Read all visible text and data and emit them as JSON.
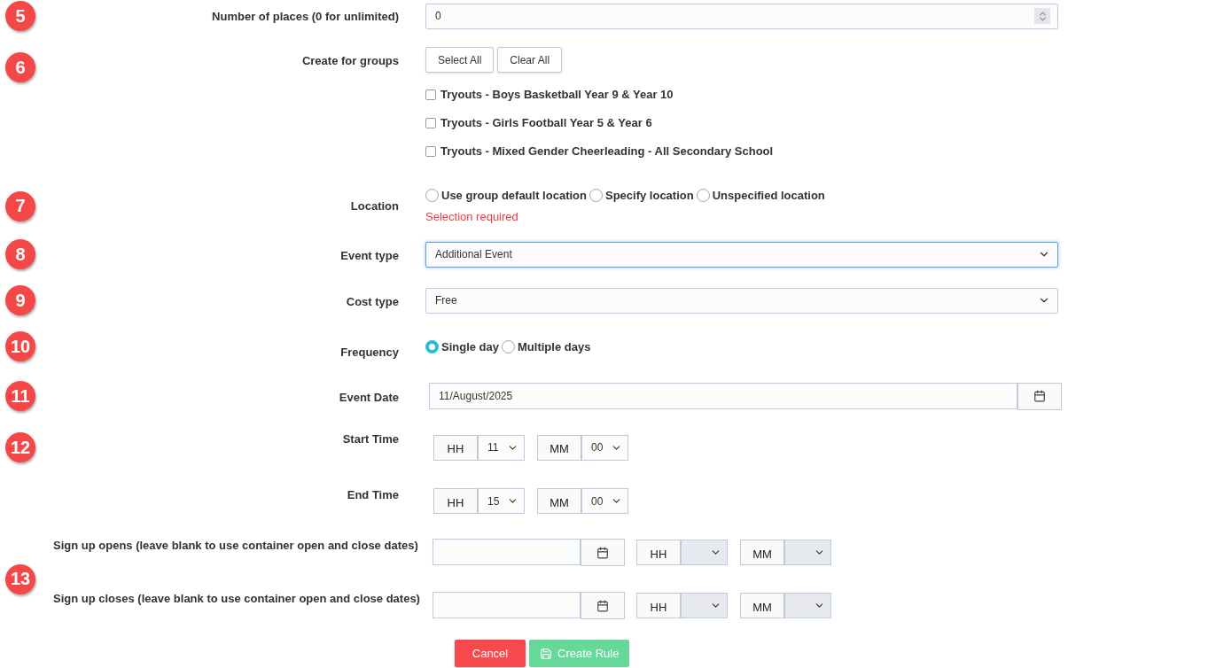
{
  "rows": [
    {
      "kind": "number",
      "step": "5",
      "label": "Number of places (0 for unlimited)",
      "value": "0"
    },
    {
      "kind": "groups",
      "step": "6",
      "label": "Create for groups",
      "buttons": [
        "Select All",
        "Clear All"
      ],
      "groups": [
        {
          "label": "Tryouts - Boys Basketball Year 9 & Year 10",
          "checked": false
        },
        {
          "label": "Tryouts - Girls Football Year 5 & Year 6",
          "checked": false
        },
        {
          "label": "Tryouts - Mixed Gender Cheerleading - All Secondary School",
          "checked": false
        }
      ]
    },
    {
      "kind": "radio",
      "step": "7",
      "label": "Location",
      "options": [
        {
          "label": "Use group default location",
          "selected": false
        },
        {
          "label": "Specify location",
          "selected": false
        },
        {
          "label": "Unspecified location",
          "selected": false
        }
      ],
      "error": "Selection required"
    },
    {
      "kind": "select",
      "step": "8",
      "label": "Event type",
      "value": "Additional Event",
      "focused": true
    },
    {
      "kind": "select",
      "step": "9",
      "label": "Cost type",
      "value": "Free",
      "focused": false
    },
    {
      "kind": "radio",
      "step": "10",
      "label": "Frequency",
      "options": [
        {
          "label": "Single day",
          "selected": true
        },
        {
          "label": "Multiple days",
          "selected": false
        }
      ]
    },
    {
      "kind": "date",
      "step": "11",
      "label": "Event Date",
      "value": "11/August/2025"
    },
    {
      "kind": "time",
      "step": "12",
      "label": "Start Time",
      "hour_label": "HH",
      "hour": "11",
      "minute_label": "MM",
      "minute": "00"
    },
    {
      "kind": "time",
      "label": "End Time",
      "hour_label": "HH",
      "hour": "15",
      "minute_label": "MM",
      "minute": "00"
    }
  ],
  "signup": {
    "step": "13",
    "rows": [
      {
        "label": "Sign up opens (leave blank to use container open and close dates)",
        "hour_label": "HH",
        "minute_label": "MM"
      },
      {
        "label": "Sign up closes (leave blank to use container open and close dates)",
        "hour_label": "HH",
        "minute_label": "MM"
      }
    ]
  },
  "actions": {
    "cancel": "Cancel",
    "create": "Create Rule"
  }
}
